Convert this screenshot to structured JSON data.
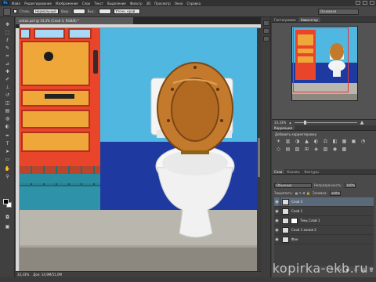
{
  "menubar": {
    "logo": "Ps",
    "items": [
      "Файл",
      "Редактирование",
      "Изображение",
      "Слои",
      "Текст",
      "Выделение",
      "Фильтр",
      "3D",
      "Просмотр",
      "Окно",
      "Справка"
    ]
  },
  "options": {
    "style_label": "Стиль:",
    "style_value": "Нормальный",
    "width_label": "Шир.:",
    "height_label": "Выс.:",
    "refine_label": "Уточн. край...",
    "workspace": "Основная"
  },
  "document": {
    "tab_title": "unitaz.psd @ 33,3% (Слой 3, RGB/8) *",
    "status_zoom": "33,33%",
    "status_doc": "Док: 14,9M/51,0M"
  },
  "panels": {
    "nav_tabs": [
      "Гистограмма",
      "Навигатор"
    ],
    "nav_zoom": "33,33%",
    "adj_tabs": [
      "Коррекция"
    ],
    "adj_caption": "Добавить корректировку",
    "adj_icons": [
      "☀",
      "▥",
      "◑",
      "▲",
      "◐",
      "⚖",
      "◧",
      "▦",
      "▣",
      "◔",
      "◇",
      "▤",
      "▧",
      "⊞",
      "◈",
      "▨",
      "◉",
      "▩"
    ],
    "layers_tabs": [
      "Слои",
      "Каналы",
      "Контуры"
    ],
    "blend_mode": "Обычные",
    "opacity_label": "Непрозрачность:",
    "opacity_value": "100%",
    "lock_label": "Закрепить:",
    "fill_label": "Заливка:",
    "fill_value": "100%",
    "layers": [
      {
        "name": "Слой 3",
        "selected": true
      },
      {
        "name": "Слой 1",
        "selected": false
      },
      {
        "name": "Тень Слой 1",
        "selected": false
      },
      {
        "name": "Слой 1 копия 2",
        "selected": false
      },
      {
        "name": "Фон",
        "selected": false
      }
    ],
    "footer_icons": [
      "⚭",
      "fx",
      "◐",
      "▭",
      "▤",
      "🗑"
    ]
  },
  "watermark": "kopirka-ekb.ru",
  "colors": {
    "accent": "#3fa0ff",
    "selected_layer": "#5b6a7a"
  }
}
